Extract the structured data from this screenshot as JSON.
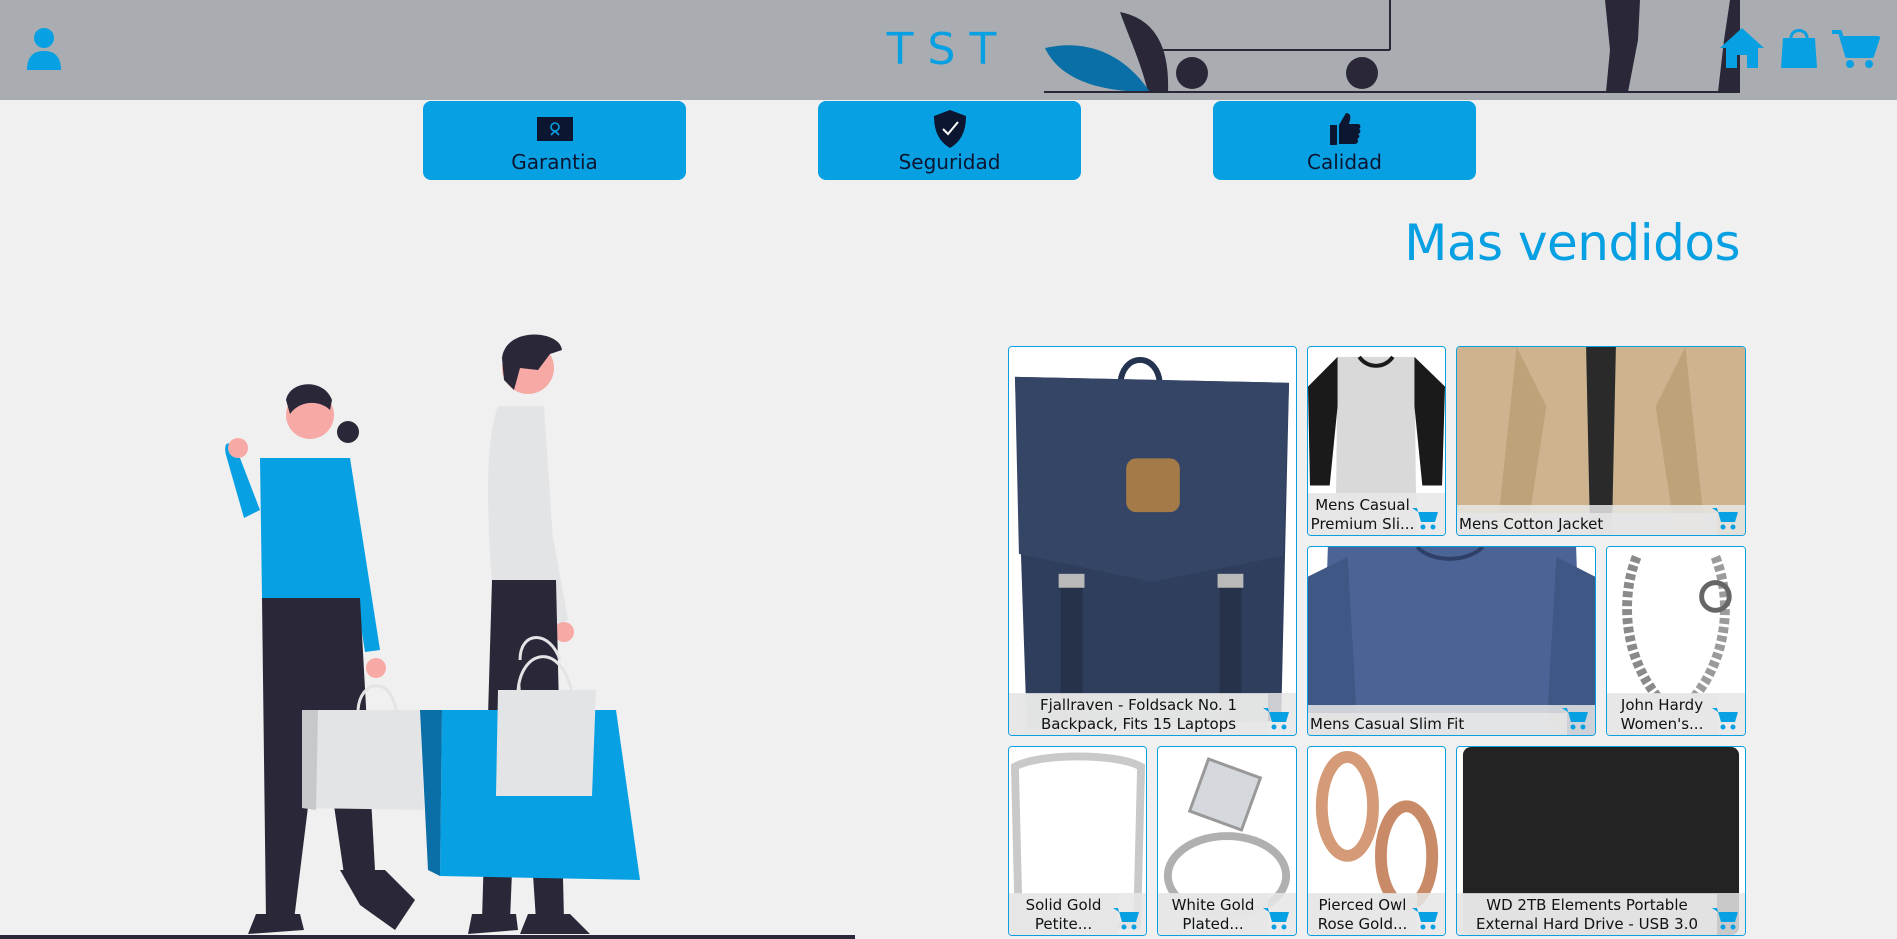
{
  "header": {
    "brand": "TST",
    "icons": [
      "user-icon",
      "home-icon",
      "shopping-bag-icon",
      "cart-icon"
    ]
  },
  "features": [
    {
      "label": "Garantia",
      "icon": "certificate-icon"
    },
    {
      "label": "Seguridad",
      "icon": "shield-check-icon"
    },
    {
      "label": "Calidad",
      "icon": "thumbs-up-icon"
    }
  ],
  "bestsellers": {
    "title": "Mas vendidos",
    "products": [
      {
        "name": "Fjallraven - Foldsack No. 1 Backpack, Fits 15 Laptops"
      },
      {
        "name": "Mens Casual Premium Sli..."
      },
      {
        "name": "Mens Cotton Jacket"
      },
      {
        "name": "Mens Casual Slim Fit"
      },
      {
        "name": "John Hardy Women's..."
      },
      {
        "name": "Solid Gold Petite..."
      },
      {
        "name": "White Gold Plated..."
      },
      {
        "name": "Pierced Owl Rose Gold..."
      },
      {
        "name": "WD 2TB Elements Portable External Hard Drive - USB 3.0"
      }
    ]
  },
  "colors": {
    "accent": "#07a0e3",
    "header_bg": "#a9adb1",
    "page_bg": "#f0f0f0",
    "dark": "#2a2838"
  }
}
